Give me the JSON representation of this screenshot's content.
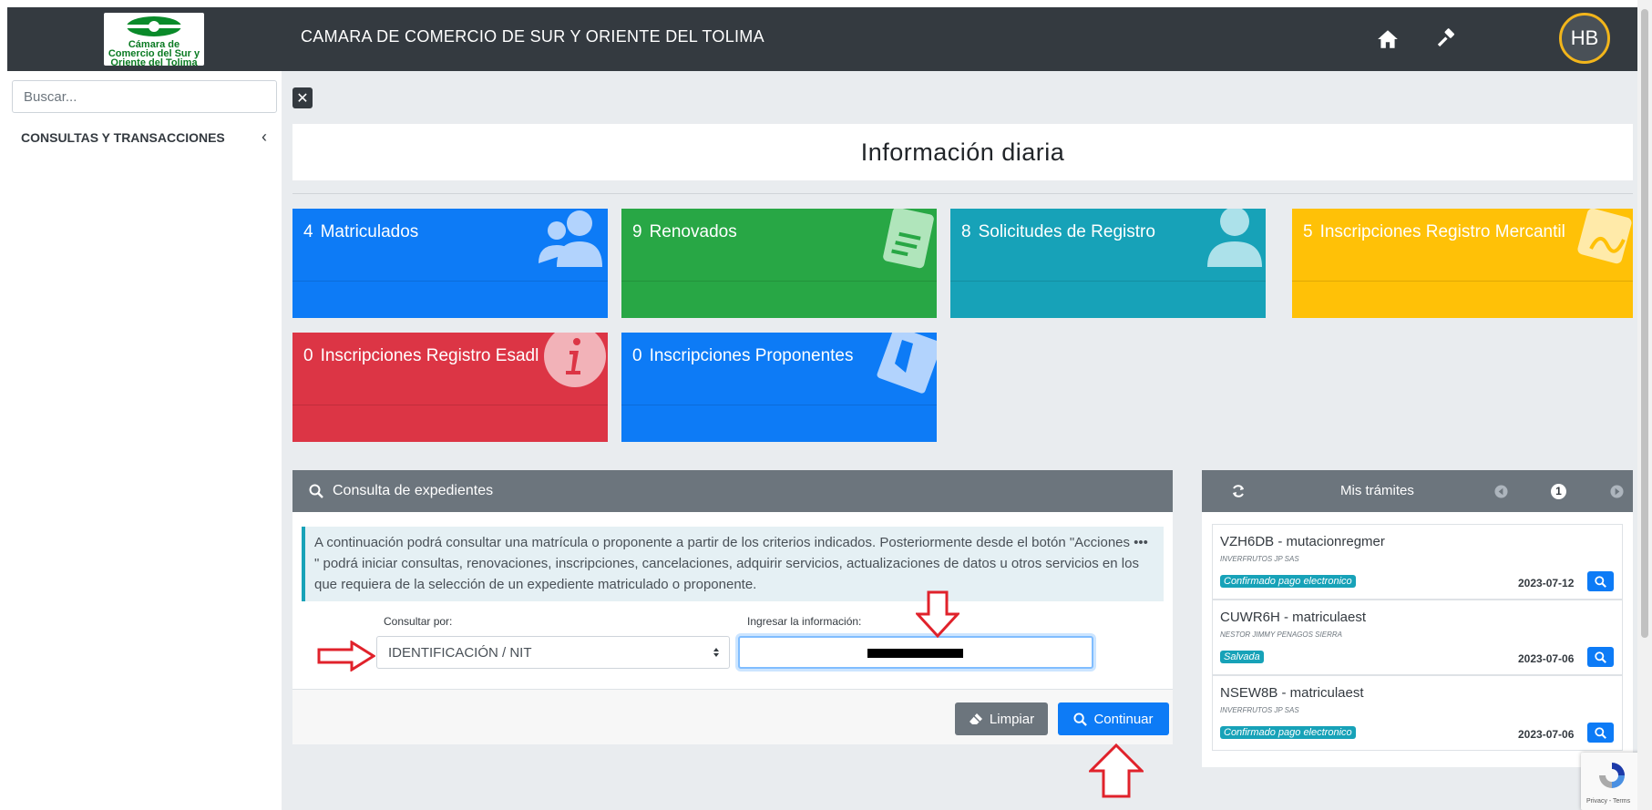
{
  "header": {
    "logo_text": "Cámara de Comercio del Sur y Oriente del Tolima",
    "title": "CAMARA DE COMERCIO DE SUR Y ORIENTE DEL TOLIMA",
    "avatar_initials": "HB",
    "icons": [
      "home-icon",
      "gavel-icon"
    ]
  },
  "sidebar": {
    "search_placeholder": "Buscar...",
    "section_label": "CONSULTAS Y TRANSACCIONES",
    "section_chevron": "‹"
  },
  "main": {
    "close_label": "✕",
    "heading": "Información diaria"
  },
  "tiles": [
    {
      "count": "4",
      "label": "Matriculados",
      "color": "#0d7bf6",
      "icon": "users-icon"
    },
    {
      "count": "9",
      "label": "Renovados",
      "color": "#28a745",
      "icon": "document-icon"
    },
    {
      "count": "8",
      "label": "Solicitudes de Registro",
      "color": "#17a2b8",
      "icon": "user-icon"
    },
    {
      "count": "5",
      "label": "Inscripciones Registro Mercantil",
      "color": "#ffc107",
      "icon": "signature-icon"
    },
    {
      "count": "0",
      "label": "Inscripciones Registro Esadl",
      "color": "#dc3545",
      "icon": "info-icon"
    },
    {
      "count": "0",
      "label": "Inscripciones Proponentes",
      "color": "#0d7bf6",
      "icon": "id-badge-icon"
    }
  ],
  "consulta": {
    "title": "Consulta de expedientes",
    "info_text": "A continuación podrá consultar una matrícula o proponente a partir de los criterios indicados. Posteriormente desde el botón \"Acciones ••• \" podrá iniciar consultas, renovaciones, inscripciones, cancelaciones, adquirir servicios, actualizaciones de datos u otros servicios en los que requiera de la selección de un expediente matriculado o proponente.",
    "consultar_label": "Consultar por:",
    "consultar_value": "IDENTIFICACIÓN / NIT",
    "ingresar_label": "Ingresar la información:",
    "limpiar_label": "Limpiar",
    "continuar_label": "Continuar"
  },
  "tramites": {
    "title": "Mis trámites",
    "page": "1",
    "items": [
      {
        "code": "VZH6DB - mutacionregmer",
        "who": "INVERFRUTOS JP SAS",
        "status": "Confirmado pago electronico",
        "date": "2023-07-12"
      },
      {
        "code": "CUWR6H - matriculaest",
        "who": "NESTOR JIMMY PENAGOS SIERRA",
        "status": "Salvada",
        "date": "2023-07-06"
      },
      {
        "code": "NSEW8B - matriculaest",
        "who": "INVERFRUTOS JP SAS",
        "status": "Confirmado pago electronico",
        "date": "2023-07-06"
      }
    ]
  },
  "recaptcha": {
    "text": "Privacy - Terms"
  },
  "colors": {
    "topbar": "#343a40",
    "accent": "#0d7bf6",
    "annotation_arrow": "#e0222b"
  }
}
